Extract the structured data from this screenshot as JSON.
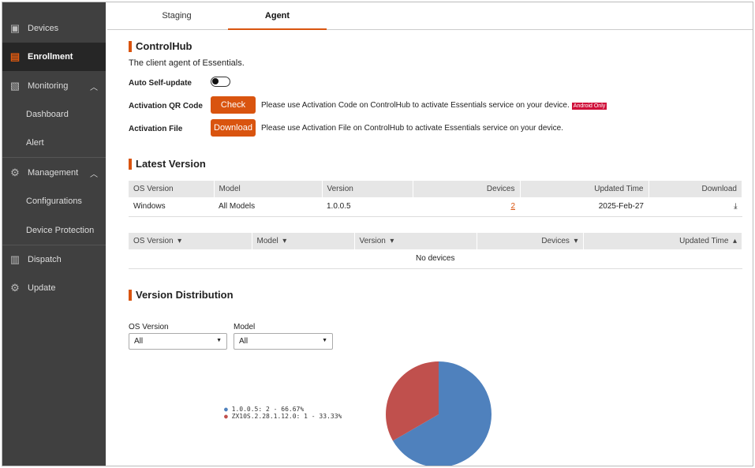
{
  "sidebar": {
    "items": [
      {
        "label": "Devices",
        "icon": "devices-icon"
      },
      {
        "label": "Enrollment",
        "icon": "enrollment-icon"
      },
      {
        "label": "Monitoring",
        "icon": "monitoring-icon"
      },
      {
        "label": "Dashboard"
      },
      {
        "label": "Alert"
      },
      {
        "label": "Management",
        "icon": "management-icon"
      },
      {
        "label": "Configurations"
      },
      {
        "label": "Device Protection"
      },
      {
        "label": "Dispatch",
        "icon": "dispatch-icon"
      },
      {
        "label": "Update",
        "icon": "update-icon"
      }
    ]
  },
  "tabs": [
    "Staging",
    "Agent"
  ],
  "controlhub": {
    "title": "ControlHub",
    "desc": "The client agent of Essentials.",
    "auto_label": "Auto Self-update",
    "auto_on": false,
    "qr_label": "Activation QR Code",
    "qr_button": "Check",
    "qr_text": "Please use Activation Code on ControlHub to activate Essentials service on your device.",
    "qr_badge": "Android Only",
    "file_label": "Activation File",
    "file_button": "Download",
    "file_text": "Please use Activation File on ControlHub to activate Essentials service on your device."
  },
  "latest": {
    "title": "Latest Version",
    "headers": [
      "OS Version",
      "Model",
      "Version",
      "Devices",
      "Updated Time",
      "Download"
    ],
    "row": {
      "os": "Windows",
      "model": "All Models",
      "version": "1.0.0.5",
      "devices": "2",
      "updated": "2025-Feb-27"
    }
  },
  "devices_table": {
    "headers": [
      "OS Version",
      "Model",
      "Version",
      "Devices",
      "Updated Time"
    ],
    "empty": "No devices"
  },
  "distribution": {
    "title": "Version Distribution",
    "os_label": "OS Version",
    "os_value": "All",
    "model_label": "Model",
    "model_value": "All"
  },
  "chart_data": {
    "type": "pie",
    "slices": [
      {
        "label": "1.0.0.5",
        "count": 2,
        "percent": 66.67,
        "color": "#4f81bd",
        "legend": "1.0.0.5: 2 - 66.67%"
      },
      {
        "label": "ZX10S.2.28.1.12.0",
        "count": 1,
        "percent": 33.33,
        "color": "#c0504d",
        "legend": "ZX10S.2.28.1.12.0: 1 - 33.33%"
      }
    ],
    "legend_position": "left"
  }
}
